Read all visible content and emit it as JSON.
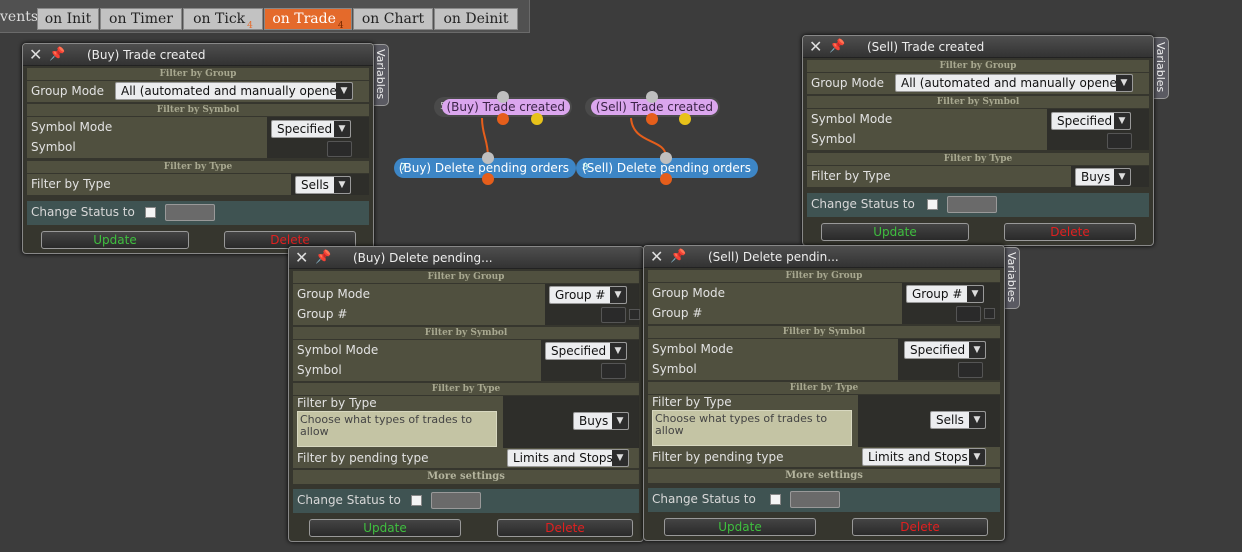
{
  "tabbar": {
    "events_label": "vents",
    "tabs": [
      {
        "label": "on Init",
        "badge": ""
      },
      {
        "label": "on Timer",
        "badge": ""
      },
      {
        "label": "on Tick",
        "badge": "4"
      },
      {
        "label": "on Trade",
        "badge": "4"
      },
      {
        "label": "on Chart",
        "badge": ""
      },
      {
        "label": "on Deinit",
        "badge": ""
      }
    ],
    "active_tab": "on Trade"
  },
  "canvas": {
    "nodes": [
      {
        "num": "5",
        "label": "(Buy) Trade created"
      },
      {
        "num": "6",
        "label": "(Sell) Trade created"
      },
      {
        "num": "7",
        "label": "(Buy) Delete pending orders"
      },
      {
        "num": "8",
        "label": "(Sell) Delete pending orders"
      }
    ],
    "colors": {
      "trigger_node": "#dba6ee",
      "action_node": "#3d86c6",
      "link": "#e55e1b",
      "output_yellow": "#e7c21a"
    }
  },
  "panels": {
    "buy_trade": {
      "title": "(Buy) Trade created",
      "variables_tab": "Variables",
      "filter_group": "Filter by Group",
      "group_mode_label": "Group Mode",
      "group_mode_value": "All (automated and manually opened)",
      "filter_symbol": "Filter by Symbol",
      "symbol_mode_label": "Symbol Mode",
      "symbol_mode_value": "Specified",
      "symbol_label": "Symbol",
      "filter_type": "Filter by Type",
      "type_label": "Filter by Type",
      "type_value": "Sells",
      "change_status_label": "Change Status to",
      "update": "Update",
      "delete": "Delete"
    },
    "sell_trade": {
      "title": "(Sell) Trade created",
      "variables_tab": "Variables",
      "filter_group": "Filter by Group",
      "group_mode_label": "Group Mode",
      "group_mode_value": "All (automated and manually opened)",
      "filter_symbol": "Filter by Symbol",
      "symbol_mode_label": "Symbol Mode",
      "symbol_mode_value": "Specified",
      "symbol_label": "Symbol",
      "filter_type": "Filter by Type",
      "type_label": "Filter by Type",
      "type_value": "Buys",
      "change_status_label": "Change Status to",
      "update": "Update",
      "delete": "Delete"
    },
    "buy_delete": {
      "title": "(Buy) Delete pending...",
      "filter_group": "Filter by Group",
      "group_mode_label": "Group Mode",
      "group_mode_value": "Group #",
      "group_num_label": "Group #",
      "filter_symbol": "Filter by Symbol",
      "symbol_mode_label": "Symbol Mode",
      "symbol_mode_value": "Specified",
      "symbol_label": "Symbol",
      "filter_type": "Filter by Type",
      "type_label": "Filter by Type",
      "type_desc": "Choose what types of trades to allow",
      "type_value": "Buys",
      "pending_label": "Filter by pending type",
      "pending_value": "Limits and Stops",
      "more_settings": "More settings",
      "change_status_label": "Change Status to",
      "update": "Update",
      "delete": "Delete"
    },
    "sell_delete": {
      "title": "(Sell) Delete pendin...",
      "variables_tab": "Variables",
      "filter_group": "Filter by Group",
      "group_mode_label": "Group Mode",
      "group_mode_value": "Group #",
      "group_num_label": "Group #",
      "filter_symbol": "Filter by Symbol",
      "symbol_mode_label": "Symbol Mode",
      "symbol_mode_value": "Specified",
      "symbol_label": "Symbol",
      "filter_type": "Filter by Type",
      "type_label": "Filter by Type",
      "type_desc": "Choose what types of trades to allow",
      "type_value": "Sells",
      "pending_label": "Filter by pending type",
      "pending_value": "Limits and Stops",
      "more_settings": "More settings",
      "change_status_label": "Change Status to",
      "update": "Update",
      "delete": "Delete"
    }
  }
}
